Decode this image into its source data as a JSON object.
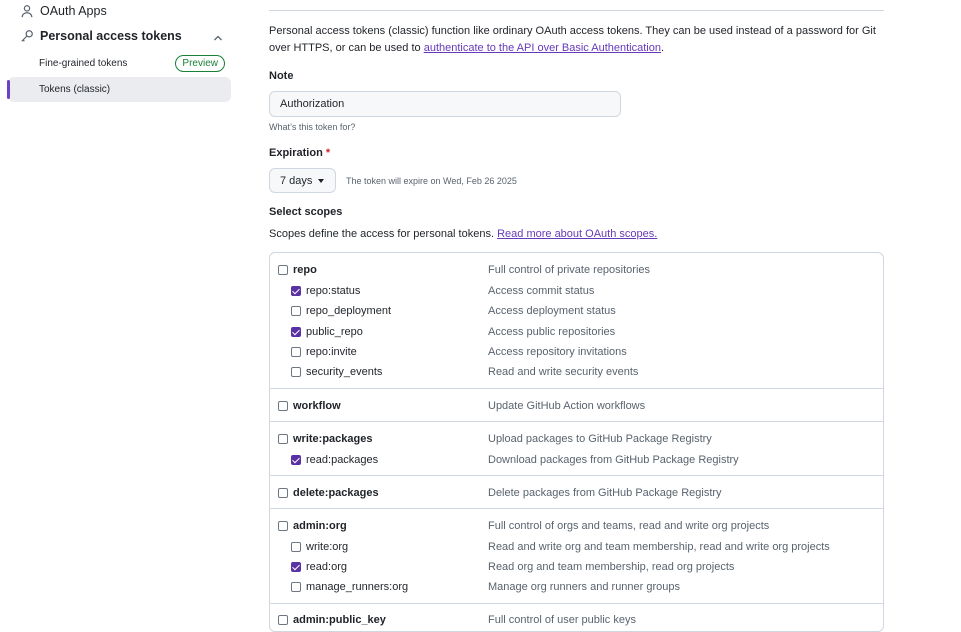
{
  "sidebar": {
    "oauth_apps": "OAuth Apps",
    "personal_access_tokens": "Personal access tokens",
    "fine_grained": "Fine-grained tokens",
    "preview_badge": "Preview",
    "tokens_classic": "Tokens (classic)"
  },
  "intro": {
    "text": "Personal access tokens (classic) function like ordinary OAuth access tokens. They can be used instead of a password for Git over HTTPS, or can be used to",
    "link": "authenticate to the API over Basic Authentication",
    "end": "."
  },
  "note": {
    "label": "Note",
    "value": "Authorization",
    "hint": "What’s this token for?"
  },
  "expiration": {
    "label": "Expiration",
    "required_mark": "*",
    "selected": "7 days",
    "info": "The token will expire on Wed, Feb 26 2025"
  },
  "scopes_section": {
    "title": "Select scopes",
    "description": "Scopes define the access for personal tokens.",
    "link": "Read more about OAuth scopes."
  },
  "scopes": {
    "repo": {
      "name": "repo",
      "desc": "Full control of private repositories",
      "checked": false
    },
    "repo_status": {
      "name": "repo:status",
      "desc": "Access commit status",
      "checked": true
    },
    "repo_deployment": {
      "name": "repo_deployment",
      "desc": "Access deployment status",
      "checked": false
    },
    "public_repo": {
      "name": "public_repo",
      "desc": "Access public repositories",
      "checked": true
    },
    "repo_invite": {
      "name": "repo:invite",
      "desc": "Access repository invitations",
      "checked": false
    },
    "security_events": {
      "name": "security_events",
      "desc": "Read and write security events",
      "checked": false
    },
    "workflow": {
      "name": "workflow",
      "desc": "Update GitHub Action workflows",
      "checked": false
    },
    "write_packages": {
      "name": "write:packages",
      "desc": "Upload packages to GitHub Package Registry",
      "checked": false
    },
    "read_packages": {
      "name": "read:packages",
      "desc": "Download packages from GitHub Package Registry",
      "checked": true
    },
    "delete_packages": {
      "name": "delete:packages",
      "desc": "Delete packages from GitHub Package Registry",
      "checked": false
    },
    "admin_org": {
      "name": "admin:org",
      "desc": "Full control of orgs and teams, read and write org projects",
      "checked": false
    },
    "write_org": {
      "name": "write:org",
      "desc": "Read and write org and team membership, read and write org projects",
      "checked": false
    },
    "read_org": {
      "name": "read:org",
      "desc": "Read org and team membership, read org projects",
      "checked": true
    },
    "manage_runners_org": {
      "name": "manage_runners:org",
      "desc": "Manage org runners and runner groups",
      "checked": false
    },
    "admin_public_key": {
      "name": "admin:public_key",
      "desc": "Full control of user public keys",
      "checked": false
    }
  }
}
